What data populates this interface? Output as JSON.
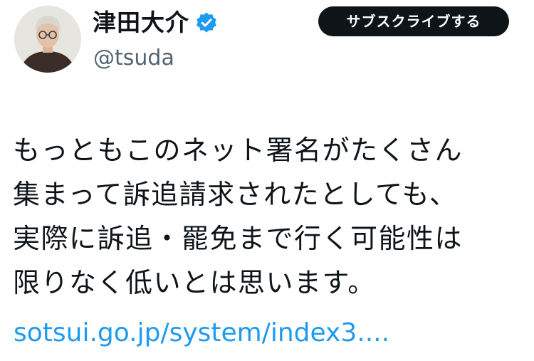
{
  "author": {
    "display_name": "津田大介",
    "handle": "@tsuda",
    "verified_icon": "verified-badge-icon",
    "accent_color": "#1d9bf0"
  },
  "subscribe_button": {
    "label": "サブスクライブする"
  },
  "tweet": {
    "lines": [
      "もっともこのネット署名がたくさん",
      "集まって訴追請求されたとしても、",
      "実際に訴追・罷免まで行く可能性は",
      "限りなく低いとは思います。"
    ],
    "link": "sotsui.go.jp/system/index3...."
  }
}
